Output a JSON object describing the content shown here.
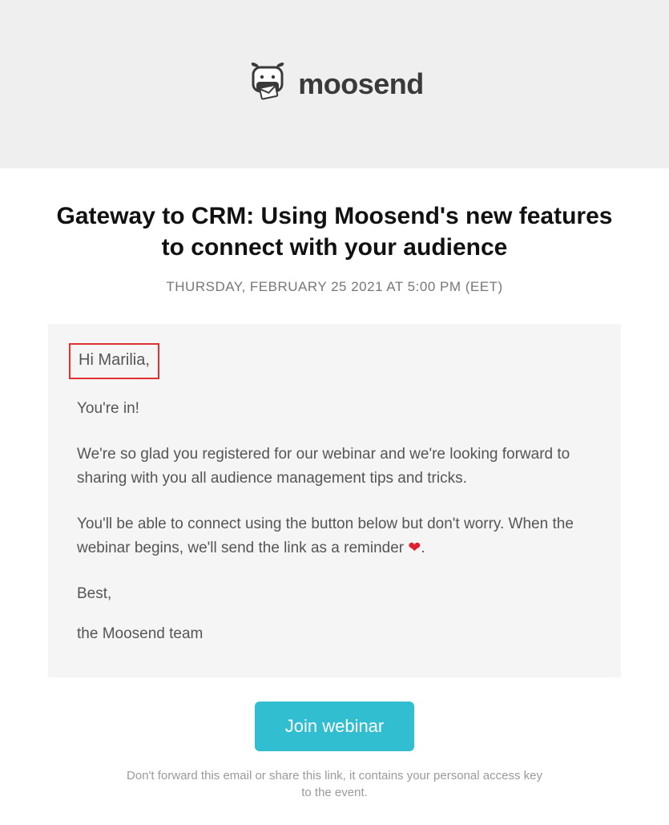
{
  "header": {
    "brand_name": "moosend"
  },
  "main": {
    "title": "Gateway to CRM: Using Moosend's new features to connect with your audience",
    "date": "THURSDAY, FEBRUARY 25 2021 AT 5:00 PM (EET)"
  },
  "body": {
    "greeting": "Hi Marilia,",
    "p1": "You're in!",
    "p2": "We're so glad you registered for our webinar and we're looking forward to sharing with you all audience management tips and tricks.",
    "p3_a": "You'll be able to connect using the button below but don't worry. When the webinar begins, we'll send the link as a reminder ",
    "p3_b": ".",
    "signoff": "Best,",
    "signature": "the Moosend team"
  },
  "cta": {
    "label": "Join webinar"
  },
  "disclaimer": "Don't forward this email or share this link, it contains your personal access key to the event."
}
